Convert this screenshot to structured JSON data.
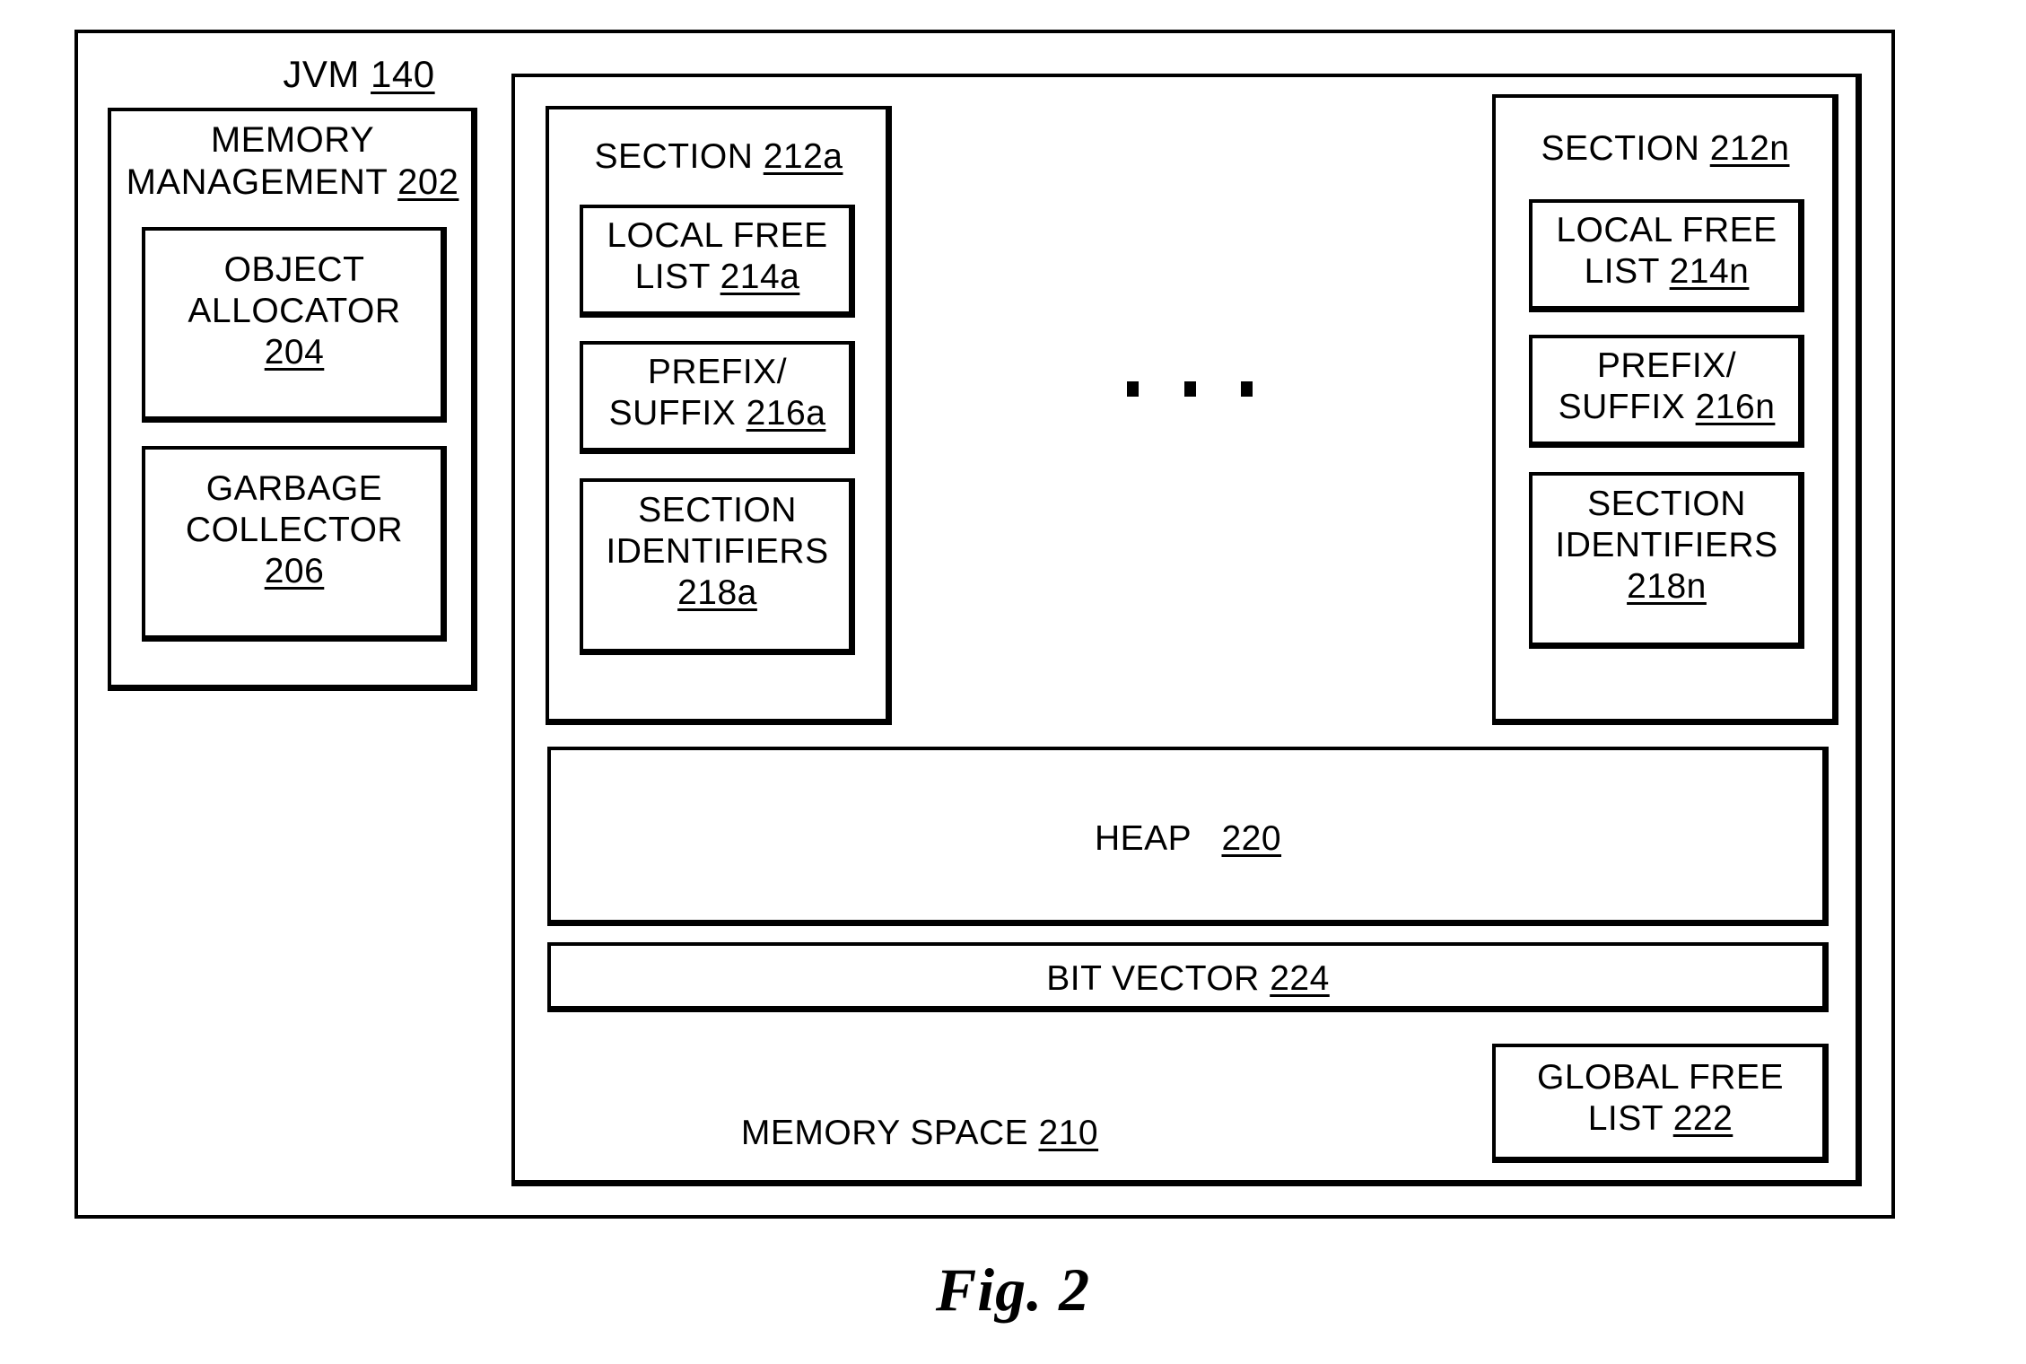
{
  "figure": {
    "caption": "Fig. 2",
    "outer": {
      "title_text": "JVM",
      "title_ref": "140"
    }
  },
  "memory_management": {
    "title_text": "MEMORY\nMANAGEMENT",
    "title_label": "MEMORY MANAGEMENT",
    "title_line1": "MEMORY",
    "title_line2": "MANAGEMENT",
    "title_ref": "202",
    "children": [
      {
        "line1": "OBJECT",
        "line2": "ALLOCATOR",
        "ref": "204"
      },
      {
        "line1": "GARBAGE",
        "line2": "COLLECTOR",
        "ref": "206"
      }
    ]
  },
  "memory_space": {
    "label": "MEMORY SPACE",
    "ref": "210",
    "ellipsis": "...",
    "sections": [
      {
        "title_label": "SECTION",
        "title_ref": "212a",
        "items": [
          {
            "line1": "LOCAL FREE",
            "line2": "LIST",
            "ref": "214a"
          },
          {
            "line1": "PREFIX/",
            "line2": "SUFFIX",
            "ref": "216a"
          },
          {
            "line1": "SECTION",
            "line2": "IDENTIFIERS",
            "ref": "218a",
            "ref_on_own_line": true
          }
        ]
      },
      {
        "title_label": "SECTION",
        "title_ref": "212n",
        "items": [
          {
            "line1": "LOCAL FREE",
            "line2": "LIST",
            "ref": "214n"
          },
          {
            "line1": "PREFIX/",
            "line2": "SUFFIX",
            "ref": "216n"
          },
          {
            "line1": "SECTION",
            "line2": "IDENTIFIERS",
            "ref": "218n",
            "ref_on_own_line": true
          }
        ]
      }
    ],
    "heap": {
      "label": "HEAP",
      "ref": "220"
    },
    "bit_vector": {
      "label": "BIT VECTOR",
      "ref": "224"
    },
    "global_free_list": {
      "line1": "GLOBAL FREE",
      "line2": "LIST",
      "ref": "222"
    }
  },
  "colors": {
    "stroke": "#000000",
    "background": "#ffffff"
  }
}
